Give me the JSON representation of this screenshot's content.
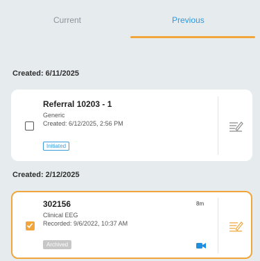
{
  "tabs": {
    "current_label": "Current",
    "previous_label": "Previous",
    "active": "Previous",
    "accent_color": "#f0a63b",
    "active_text_color": "#2b9be0"
  },
  "sections": [
    {
      "heading": "Created: 6/11/2025",
      "card": {
        "title": "Referral 10203 - 1",
        "subtitle": "Generic",
        "detail": "Created: 6/12/2025, 2:56 PM",
        "badge": "Initiated",
        "checked": false,
        "action_icon": "sign-document-icon"
      }
    },
    {
      "heading": "Created: 2/12/2025",
      "card": {
        "title": "302156",
        "subtitle": "Clinical EEG",
        "detail": "Recorded: 9/6/2022, 10:37 AM",
        "badge": "Archived",
        "duration": "8m",
        "checked": true,
        "media_icon": "video-camera-icon",
        "action_icon": "sign-document-icon"
      }
    }
  ]
}
